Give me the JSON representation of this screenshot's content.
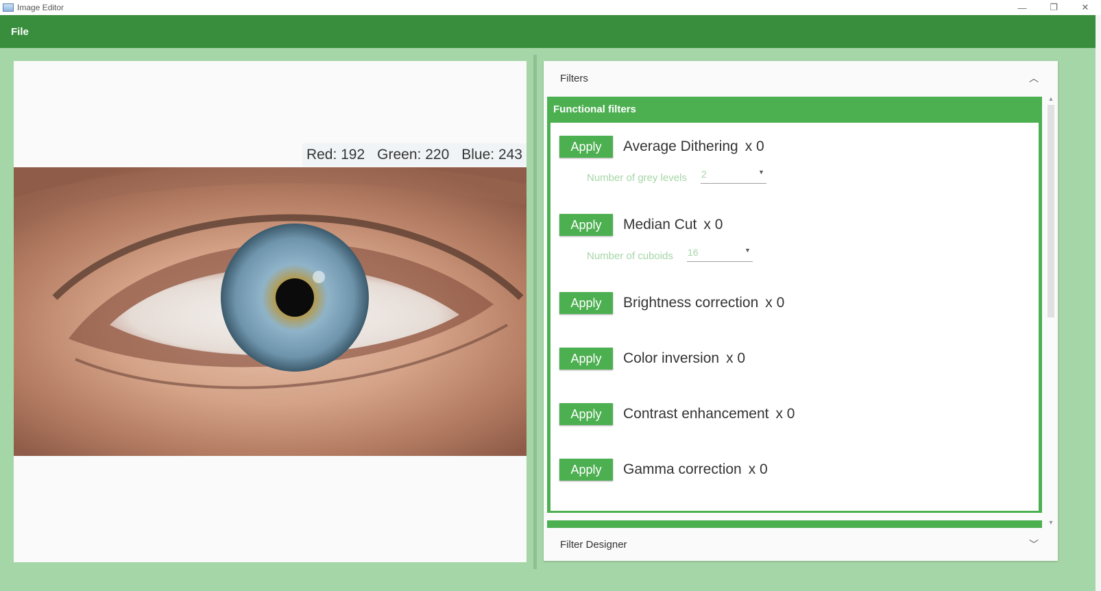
{
  "window": {
    "title": "Image Editor",
    "controls": [
      {
        "icon": "minimize-icon",
        "glyph": "—"
      },
      {
        "icon": "restore-icon",
        "glyph": "❐"
      },
      {
        "icon": "close-icon",
        "glyph": "✕"
      }
    ]
  },
  "menu": {
    "file_label": "File"
  },
  "pixel_readout": {
    "red": "Red: 192",
    "green": "Green: 220",
    "blue": "Blue: 243"
  },
  "filters_panel": {
    "header": "Filters",
    "group_title": "Functional filters",
    "apply_label": "Apply",
    "items": [
      {
        "name": "Average Dithering",
        "count": "x 0",
        "param_label": "Number of grey levels",
        "param_value": "2"
      },
      {
        "name": "Median Cut",
        "count": "x 0",
        "param_label": "Number of cuboids",
        "param_value": "16"
      },
      {
        "name": "Brightness correction",
        "count": "x 0"
      },
      {
        "name": "Color inversion",
        "count": "x 0"
      },
      {
        "name": "Contrast enhancement",
        "count": "x 0"
      },
      {
        "name": "Gamma correction",
        "count": "x 0"
      }
    ]
  },
  "filter_designer": {
    "header": "Filter Designer"
  },
  "colors": {
    "app_bar": "#388e3c",
    "accent": "#4caf50",
    "background": "#a5d6a7",
    "param_text": "#a5d6a7"
  }
}
